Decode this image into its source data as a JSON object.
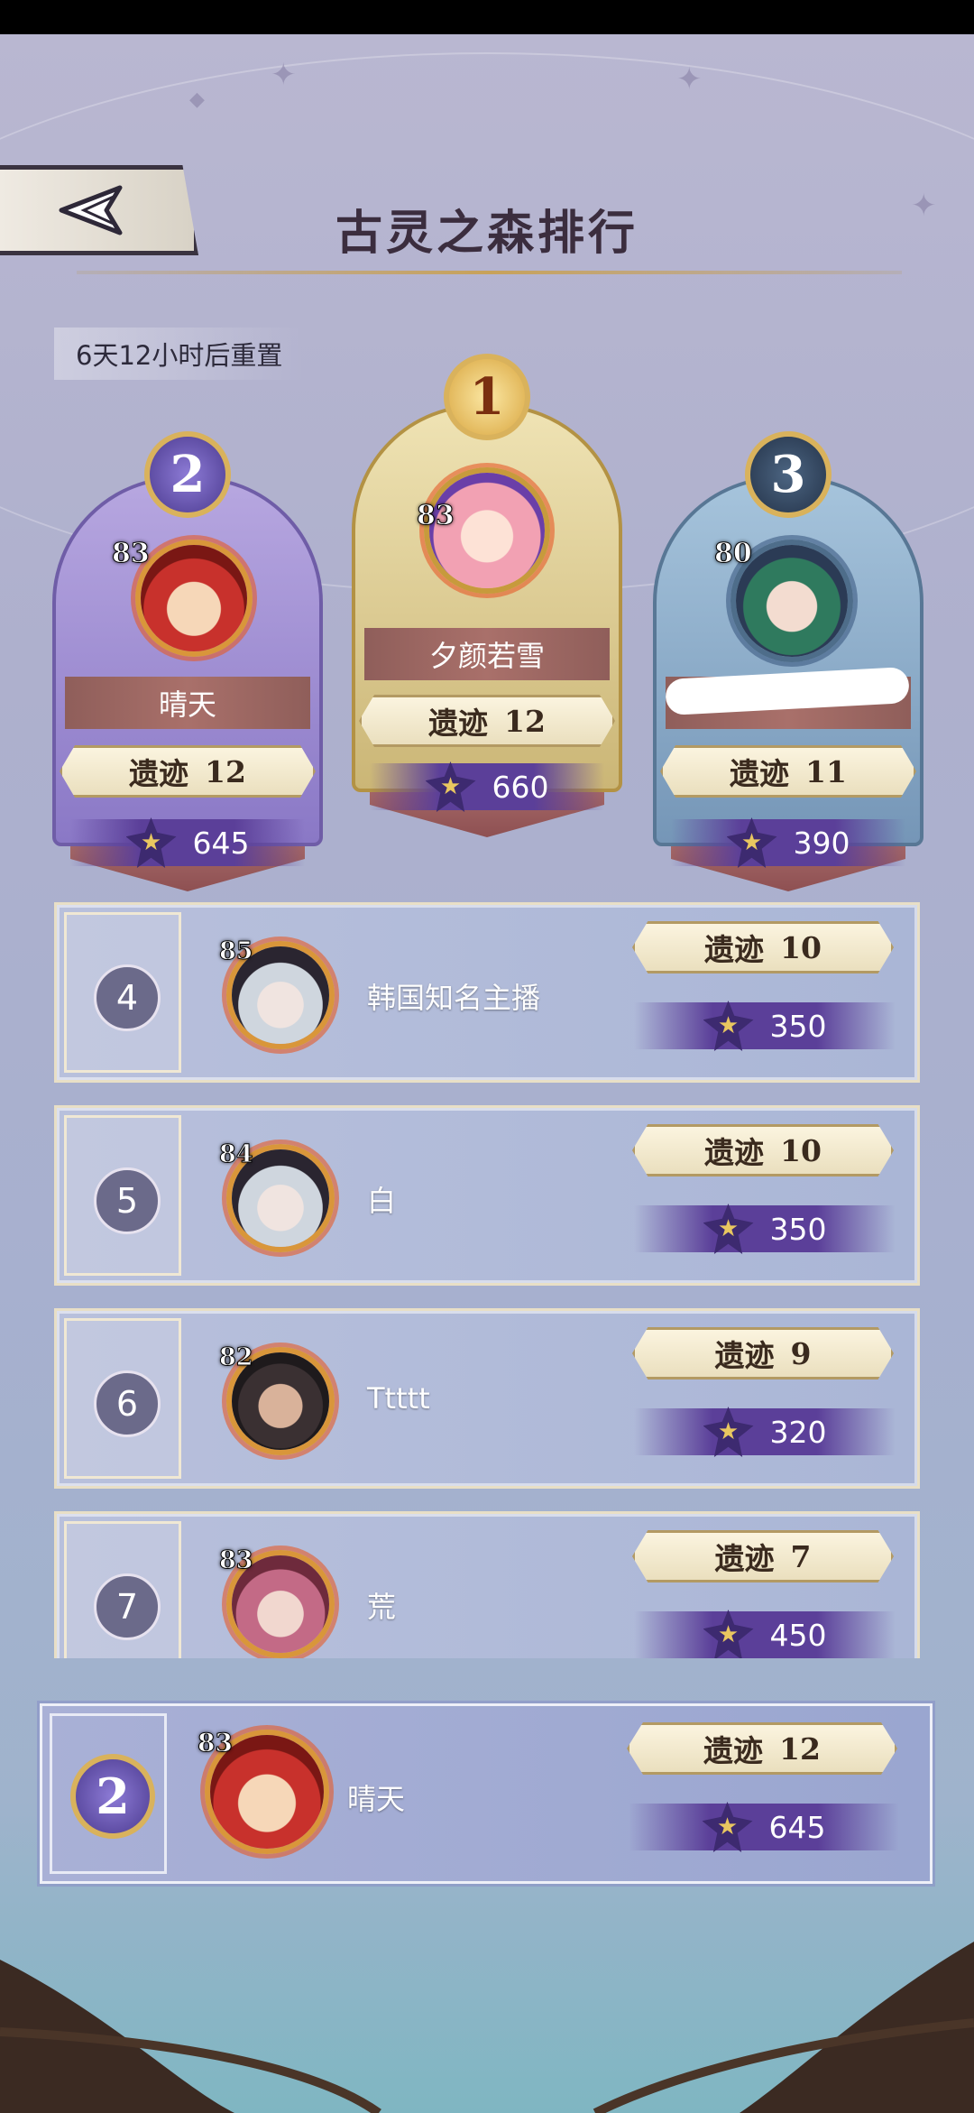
{
  "title": "古灵之森排行",
  "reset_timer": "6天12小时后重置",
  "relic_label": "遗迹",
  "podium": [
    {
      "rank": "2",
      "name": "晴天",
      "level": "83",
      "relics": "12",
      "score": "645",
      "theme": "purple"
    },
    {
      "rank": "1",
      "name": "夕颜若雪",
      "level": "83",
      "relics": "12",
      "score": "660",
      "theme": "gold"
    },
    {
      "rank": "3",
      "name": "",
      "level": "80",
      "relics": "11",
      "score": "390",
      "theme": "blue"
    }
  ],
  "list": [
    {
      "rank": "4",
      "name": "韩国知名主播",
      "level": "85",
      "relics": "10",
      "score": "350"
    },
    {
      "rank": "5",
      "name": "白",
      "level": "84",
      "relics": "10",
      "score": "350"
    },
    {
      "rank": "6",
      "name": "Ttttt",
      "level": "82",
      "relics": "9",
      "score": "320"
    },
    {
      "rank": "7",
      "name": "荒",
      "level": "83",
      "relics": "7",
      "score": "450"
    }
  ],
  "me": {
    "rank": "2",
    "name": "晴天",
    "level": "83",
    "relics": "12",
    "score": "645"
  },
  "colors": {
    "gold": "#d9b25c",
    "purple_score": "#5b3f99",
    "plate": "#a9706a"
  }
}
